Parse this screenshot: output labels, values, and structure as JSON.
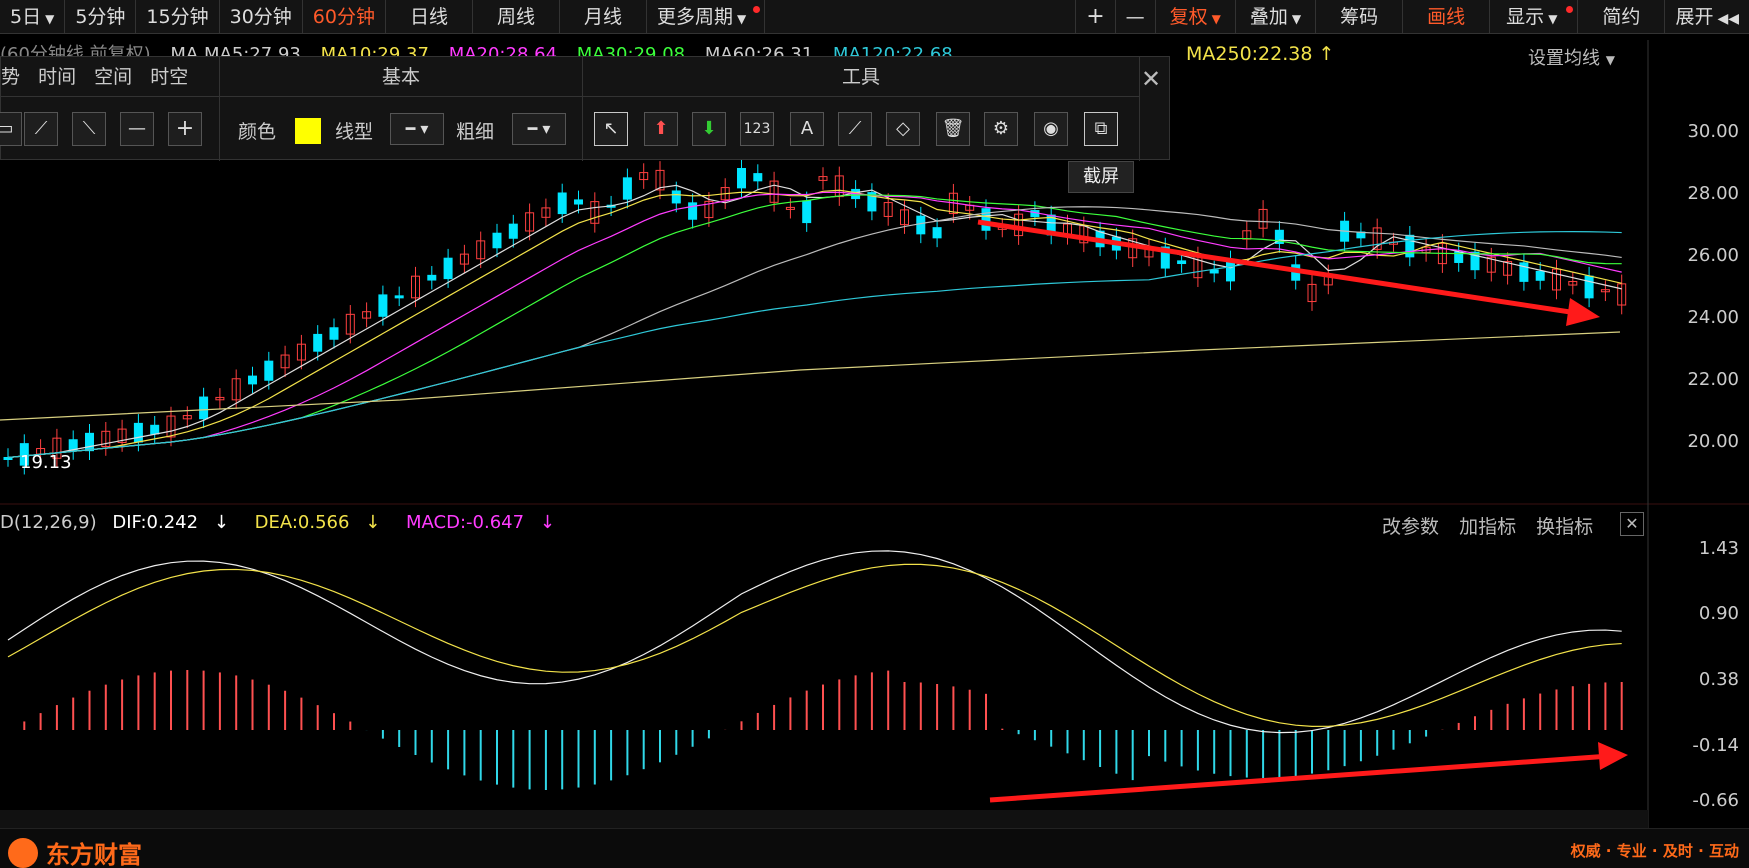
{
  "topbar": {
    "periods": [
      "5日",
      "5分钟",
      "15分钟",
      "30分钟",
      "60分钟",
      "日线",
      "周线",
      "月线",
      "更多周期"
    ],
    "active_period": "60分钟",
    "right_buttons": [
      "+",
      "—",
      "复权",
      "叠加",
      "筹码",
      "画线",
      "显示",
      "简约",
      "展开"
    ]
  },
  "ma_legend": {
    "items": [
      {
        "label": "(60分钟线 前复权)",
        "color": "#888888"
      },
      {
        "label": "MA  MA5:27.93",
        "color": "#cccccc"
      },
      {
        "label": "MA10:29.37",
        "color": "#f2e24a"
      },
      {
        "label": "MA20:28.64",
        "color": "#ff3cff"
      },
      {
        "label": "MA30:29.08",
        "color": "#3cff3c"
      },
      {
        "label": "MA60:26.31",
        "color": "#cccccc"
      },
      {
        "label": "MA120:22.68",
        "color": "#2ec8d8"
      }
    ],
    "ma250": "MA250:22.38",
    "setting": "设置均线"
  },
  "panel": {
    "left_tabs": [
      "势",
      "时间",
      "空间",
      "时空"
    ],
    "section_basic": "基本",
    "section_tools": "工具",
    "color_label": "颜色",
    "color_value": "#ffff00",
    "linetype_label": "线型",
    "thickness_label": "粗细",
    "tooltip": "截屏",
    "basic_tool_icons": [
      "rectangle-tool-icon",
      "diagonal-line-icon",
      "reverse-diagonal-icon",
      "horizontal-line-icon",
      "crosshair-icon"
    ],
    "tool_icons": [
      "cursor-arrow-icon",
      "red-up-arrow-icon",
      "green-down-arrow-icon",
      "number-label-icon",
      "text-tool-icon",
      "ruler-icon",
      "eraser-icon",
      "trash-icon",
      "settings-gear-icon",
      "eye-icon",
      "screenshot-icon"
    ]
  },
  "price_axis": [
    "30.00",
    "28.00",
    "26.00",
    "24.00",
    "22.00",
    "20.00"
  ],
  "low_label": "19.13",
  "macd": {
    "title": "D(12,26,9)",
    "dif": "DIF:0.242",
    "dea": "DEA:0.566",
    "macd": "MACD:-0.647",
    "tools": [
      "改参数",
      "加指标",
      "换指标"
    ],
    "axis": [
      "1.43",
      "0.90",
      "0.38",
      "-0.14",
      "-0.66"
    ]
  },
  "footer": {
    "logo": "东方财富",
    "slogan": "权威 · 专业 · 及时 · 互动"
  }
}
